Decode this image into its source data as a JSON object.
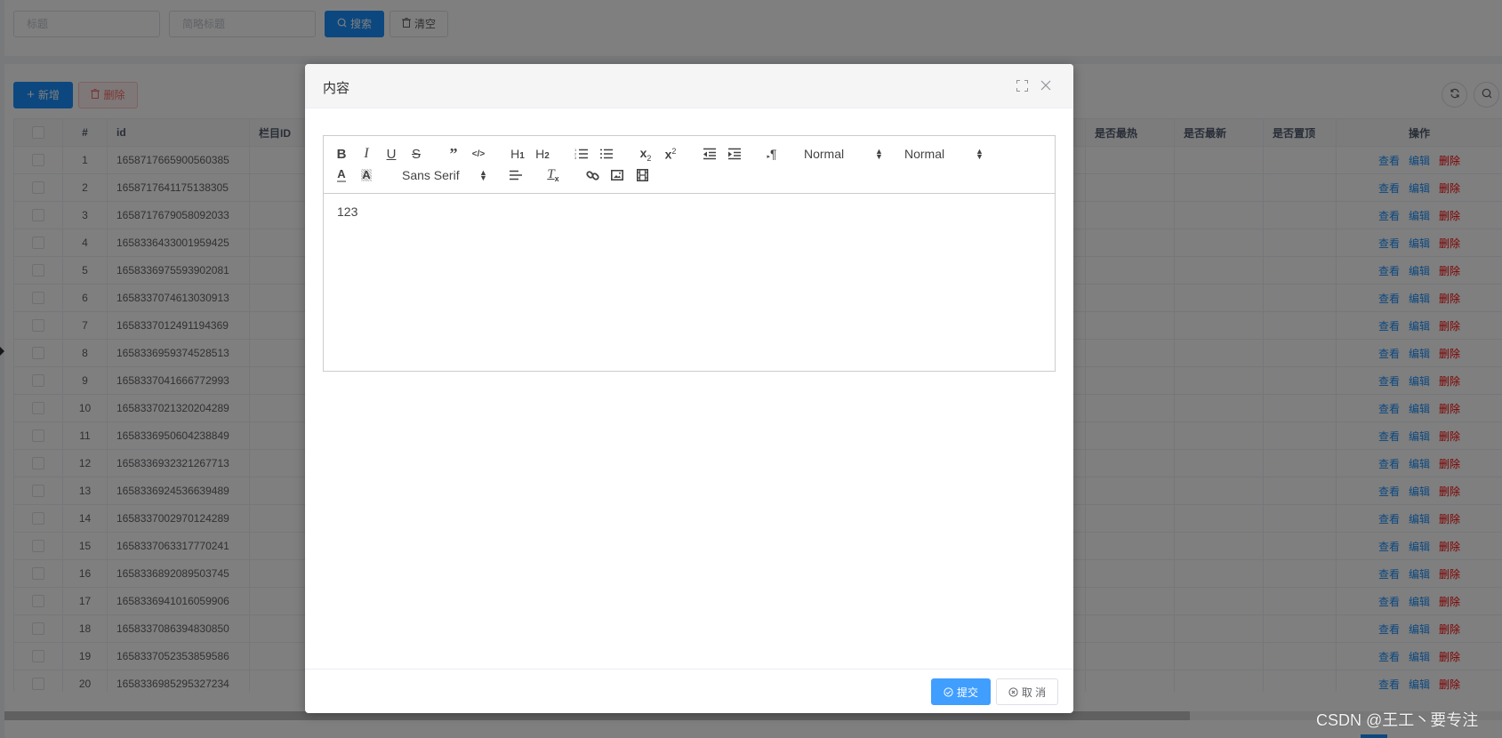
{
  "search": {
    "title_placeholder": "标题",
    "short_title_placeholder": "简略标题",
    "search_label": "搜索",
    "clear_label": "清空"
  },
  "actions": {
    "add_label": "新增",
    "delete_label": "删除"
  },
  "table": {
    "columns": [
      "#",
      "id",
      "栏目ID",
      "是否最热",
      "是否最新",
      "是否置顶",
      "操作"
    ],
    "row_actions": {
      "view": "查看",
      "edit": "编辑",
      "delete": "删除"
    },
    "rows": [
      {
        "index": "1",
        "id": "1658717665900560385"
      },
      {
        "index": "2",
        "id": "1658717641175138305"
      },
      {
        "index": "3",
        "id": "1658717679058092033"
      },
      {
        "index": "4",
        "id": "1658336433001959425"
      },
      {
        "index": "5",
        "id": "1658336975593902081"
      },
      {
        "index": "6",
        "id": "1658337074613030913"
      },
      {
        "index": "7",
        "id": "1658337012491194369"
      },
      {
        "index": "8",
        "id": "1658336959374528513"
      },
      {
        "index": "9",
        "id": "1658337041666772993"
      },
      {
        "index": "10",
        "id": "1658337021320204289"
      },
      {
        "index": "11",
        "id": "1658336950604238849"
      },
      {
        "index": "12",
        "id": "1658336932321267713"
      },
      {
        "index": "13",
        "id": "1658336924536639489"
      },
      {
        "index": "14",
        "id": "1658337002970124289"
      },
      {
        "index": "15",
        "id": "1658337063317770241"
      },
      {
        "index": "16",
        "id": "1658336892089503745"
      },
      {
        "index": "17",
        "id": "1658336941016059906"
      },
      {
        "index": "18",
        "id": "1658337086394830850"
      },
      {
        "index": "19",
        "id": "1658337052353859586"
      },
      {
        "index": "20",
        "id": "1658336985295327234"
      }
    ]
  },
  "modal": {
    "title": "内容",
    "editor": {
      "header_select": "Normal",
      "size_select": "Normal",
      "font_select": "Sans Serif",
      "content": "123"
    },
    "submit_label": "提交",
    "cancel_label": "取 消"
  },
  "colors": {
    "primary": "#1890ff",
    "modal_primary": "#409eff",
    "danger": "#ff0000"
  },
  "watermark": "CSDN @王工丶要专注"
}
